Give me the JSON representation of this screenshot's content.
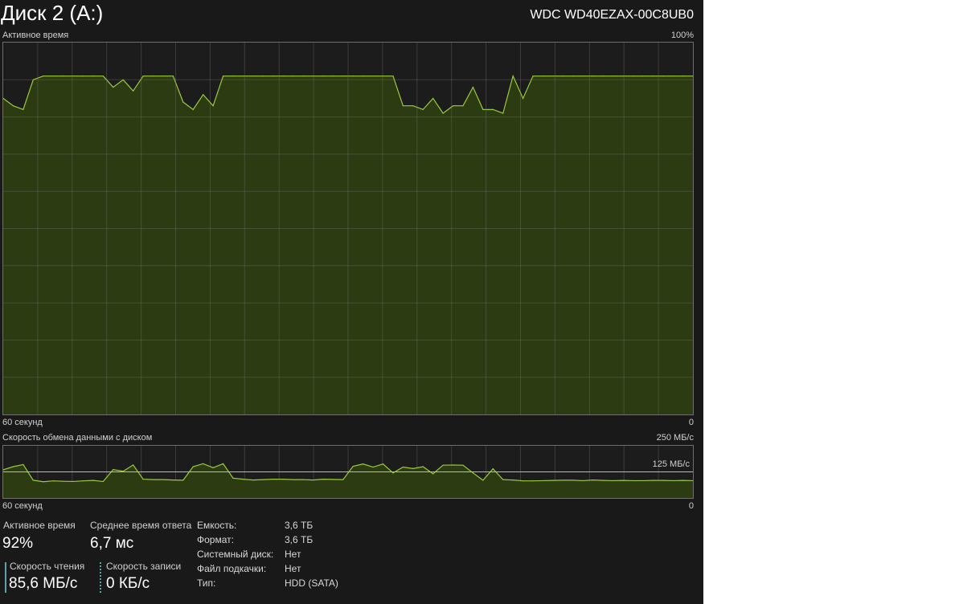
{
  "header": {
    "title": "Диск 2 (A:)",
    "model": "WDC WD40EZAX-00C8UB0"
  },
  "active_chart": {
    "label": "Активное время",
    "max_label": "100%",
    "x_left_label": "60 секунд",
    "x_right_label": "0",
    "line_color": "#9acb3e",
    "fill_color": "#2d3b12",
    "values": [
      85,
      83,
      82,
      90,
      91,
      91,
      91,
      91,
      91,
      91,
      91,
      88,
      90,
      87,
      91,
      91,
      91,
      91,
      84,
      82,
      86,
      83,
      91,
      91,
      91,
      91,
      91,
      91,
      91,
      91,
      91,
      91,
      91,
      91,
      91,
      91,
      91,
      91,
      91,
      91,
      83,
      83,
      82,
      85,
      81,
      83,
      83,
      88,
      82,
      82,
      81,
      91,
      85,
      91,
      91,
      91,
      91,
      91,
      91,
      91,
      91,
      91,
      91,
      91,
      91,
      91,
      91,
      91,
      91,
      91
    ]
  },
  "transfer_chart": {
    "label": "Скорость обмена данными с диском",
    "max_label": "250 МБ/с",
    "mid_label": "125 МБ/с",
    "x_left_label": "60 секунд",
    "x_right_label": "0",
    "ylim": [
      0,
      250
    ],
    "read_values": [
      135,
      150,
      160,
      85,
      78,
      82,
      80,
      79,
      82,
      84,
      79,
      136,
      128,
      158,
      90,
      88,
      88,
      86,
      85,
      150,
      164,
      145,
      164,
      95,
      90,
      86,
      88,
      90,
      90,
      88,
      88,
      86,
      90,
      89,
      88,
      152,
      163,
      148,
      163,
      120,
      148,
      141,
      150,
      116,
      157,
      158,
      157,
      120,
      85,
      140,
      88,
      86,
      82,
      82,
      83,
      84,
      85,
      85,
      83,
      86,
      84,
      83,
      84,
      83,
      83,
      84,
      84,
      83,
      84,
      83
    ],
    "read_color": "#9acb3e",
    "fill_color": "#2d3b12"
  },
  "stats": {
    "active_time": {
      "label": "Активное время",
      "value": "92%"
    },
    "response_time": {
      "label": "Среднее время ответа",
      "value": "6,7 мс"
    },
    "read_speed": {
      "label": "Скорость чтения",
      "value": "85,6 МБ/с"
    },
    "write_speed": {
      "label": "Скорость записи",
      "value": "0 КБ/с"
    }
  },
  "properties": [
    {
      "key": "Емкость:",
      "value": "3,6 ТБ"
    },
    {
      "key": "Формат:",
      "value": "3,6 ТБ"
    },
    {
      "key": "Системный диск:",
      "value": "Нет"
    },
    {
      "key": "Файл подкачки:",
      "value": "Нет"
    },
    {
      "key": "Тип:",
      "value": "HDD (SATA)"
    }
  ]
}
